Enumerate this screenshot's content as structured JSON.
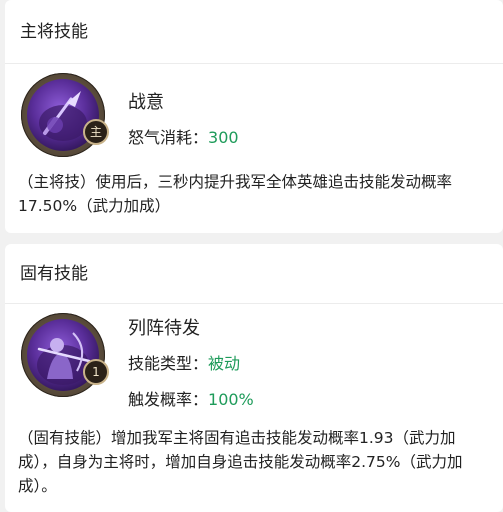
{
  "sections": [
    {
      "header": "主将技能",
      "skill_name": "战意",
      "badge": "主",
      "stats": [
        {
          "label": "怒气消耗：",
          "value": "300"
        }
      ],
      "description": "（主将技）使用后，三秒内提升我军全体英雄追击技能发动概率17.50%（武力加成）"
    },
    {
      "header": "固有技能",
      "skill_name": "列阵待发",
      "badge": "1",
      "stats": [
        {
          "label": "技能类型：",
          "value": "被动"
        },
        {
          "label": "触发概率：",
          "value": "100%"
        }
      ],
      "description": "（固有技能）增加我军主将固有追击技能发动概率1.93（武力加成），自身为主将时，增加自身追击技能发动概率2.75%（武力加成）。"
    }
  ],
  "colors": {
    "accent_value": "#1e9b5a",
    "icon_purple": "#5a2e9a"
  },
  "icons": [
    "spear-skill-icon",
    "archer-skill-icon"
  ]
}
